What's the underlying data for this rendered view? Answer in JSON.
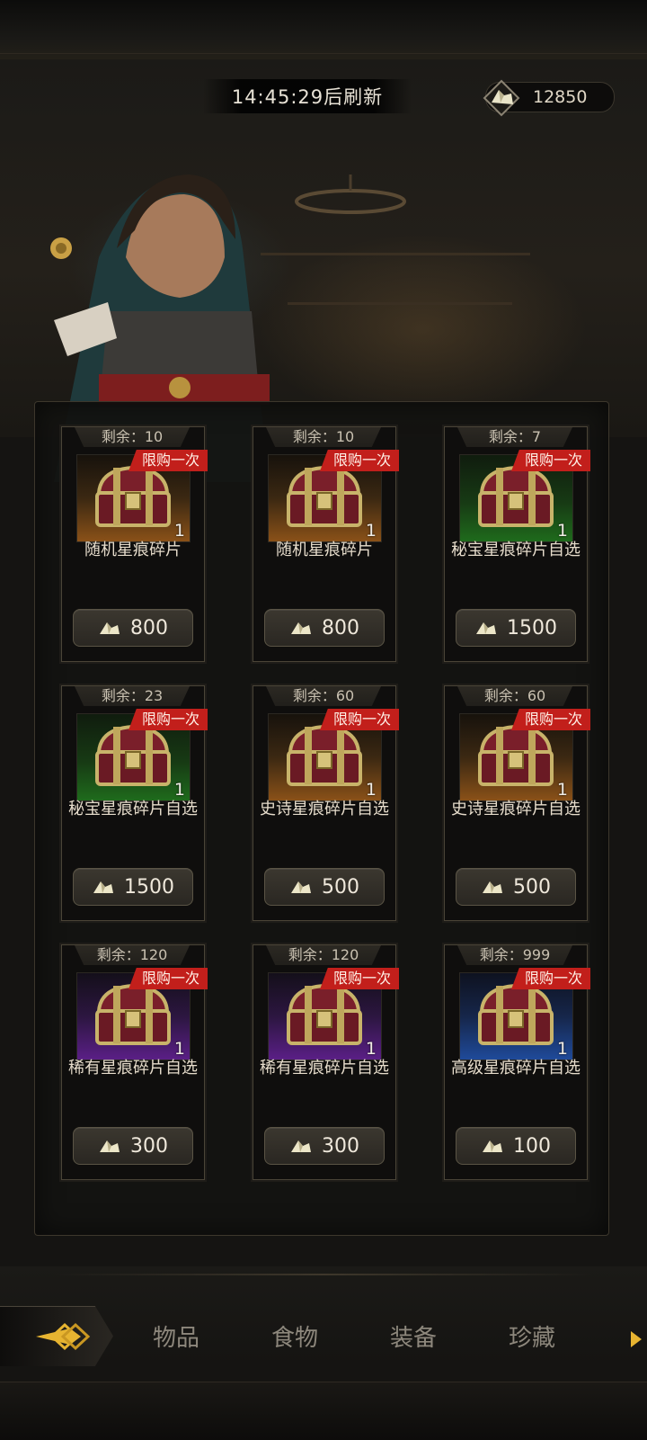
{
  "header": {
    "refresh_timer": "14:45:29后刷新",
    "currency": {
      "value": "12850",
      "icon": "crystal-shard-icon"
    }
  },
  "shop": {
    "items": [
      {
        "remain": "剩余：10",
        "limit": "限购一次",
        "qty": "1",
        "name": "随机星痕碎片",
        "price": "800",
        "rarity": "orange"
      },
      {
        "remain": "剩余：10",
        "limit": "限购一次",
        "qty": "1",
        "name": "随机星痕碎片",
        "price": "800",
        "rarity": "orange"
      },
      {
        "remain": "剩余：7",
        "limit": "限购一次",
        "qty": "1",
        "name": "秘宝星痕碎片自选",
        "price": "1500",
        "rarity": "green"
      },
      {
        "remain": "剩余：23",
        "limit": "限购一次",
        "qty": "1",
        "name": "秘宝星痕碎片自选",
        "price": "1500",
        "rarity": "green"
      },
      {
        "remain": "剩余：60",
        "limit": "限购一次",
        "qty": "1",
        "name": "史诗星痕碎片自选",
        "price": "500",
        "rarity": "orange"
      },
      {
        "remain": "剩余：60",
        "limit": "限购一次",
        "qty": "1",
        "name": "史诗星痕碎片自选",
        "price": "500",
        "rarity": "orange"
      },
      {
        "remain": "剩余：120",
        "limit": "限购一次",
        "qty": "1",
        "name": "稀有星痕碎片自选",
        "price": "300",
        "rarity": "purple"
      },
      {
        "remain": "剩余：120",
        "limit": "限购一次",
        "qty": "1",
        "name": "稀有星痕碎片自选",
        "price": "300",
        "rarity": "purple"
      },
      {
        "remain": "剩余：999",
        "limit": "限购一次",
        "qty": "1",
        "name": "高级星痕碎片自选",
        "price": "100",
        "rarity": "blue"
      }
    ]
  },
  "nav": {
    "tabs": [
      "物品",
      "食物",
      "装备",
      "珍藏"
    ]
  },
  "colors": {
    "limit_badge": "#c21f1b",
    "rarity_orange": "#8a5118",
    "rarity_green": "#1f6b1c",
    "rarity_purple": "#5a1f86",
    "rarity_blue": "#1f4a9a"
  }
}
